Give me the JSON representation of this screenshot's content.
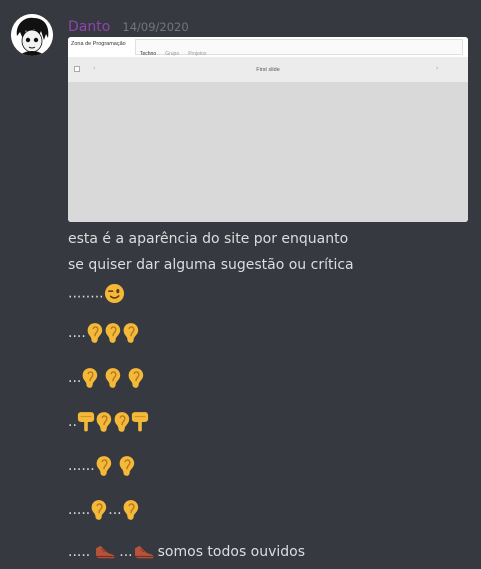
{
  "message": {
    "author": "Danto",
    "timestamp": "14/09/2020",
    "attachment": {
      "brand": "Zona de Programação",
      "tabs": [
        "Techno",
        "Grupo",
        "Projetos"
      ],
      "carousel_caption": "First slide"
    },
    "lines": [
      "esta é a aparência do site por enquanto",
      "se quiser dar alguma sugestão ou crítica",
      "........",
      "....",
      "...",
      "..",
      "......",
      ".....",
      "....."
    ],
    "inner_dots": [
      "...",
      "..."
    ],
    "closing_text": "somos todos ouvidos"
  },
  "icons": [
    "winking-face-icon",
    "ear-icon",
    "pointing-down-icon",
    "shoe-icon"
  ],
  "colors": {
    "background": "#36393f",
    "username": "#8e44ad",
    "text": "#dcddde",
    "timestamp": "#72767d"
  }
}
